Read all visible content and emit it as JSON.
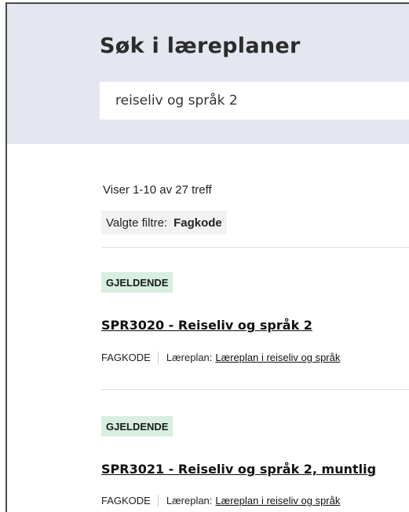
{
  "header": {
    "title": "Søk i læreplaner",
    "search_value": "reiseliv og språk 2"
  },
  "summary": {
    "count_text": "Viser 1-10 av 27 treff",
    "filters_label": "Valgte filtre:",
    "filter_chip": "Fagkode"
  },
  "results": [
    {
      "status": "GJELDENDE",
      "title": "SPR3020 - Reiseliv og språk 2",
      "type": "FAGKODE",
      "plan_label": "Læreplan:",
      "plan_link": "Læreplan i reiseliv og språk"
    },
    {
      "status": "GJELDENDE",
      "title": "SPR3021 - Reiseliv og språk 2, muntlig",
      "type": "FAGKODE",
      "plan_label": "Læreplan:",
      "plan_link": "Læreplan i reiseliv og språk"
    }
  ],
  "colors": {
    "hero_background": "#e4e6f0",
    "status_badge": "#d6efe1",
    "filter_background": "#f2f2f2"
  }
}
